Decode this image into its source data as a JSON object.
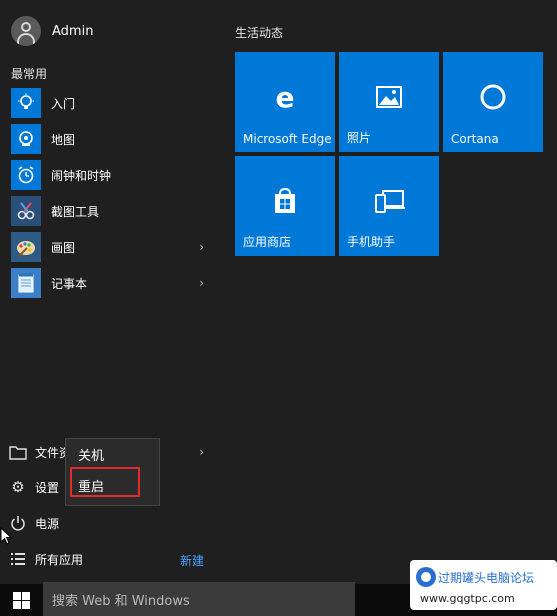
{
  "user": {
    "name": "Admin"
  },
  "most_used_label": "最常用",
  "apps": [
    {
      "label": "入门",
      "icon": "lightbulb-icon",
      "has_submenu": false
    },
    {
      "label": "地图",
      "icon": "maps-icon",
      "has_submenu": false
    },
    {
      "label": "闹钟和时钟",
      "icon": "alarm-clock-icon",
      "has_submenu": false
    },
    {
      "label": "截图工具",
      "icon": "snipping-tool-icon",
      "has_submenu": false
    },
    {
      "label": "画图",
      "icon": "paint-icon",
      "has_submenu": true
    },
    {
      "label": "记事本",
      "icon": "notepad-icon",
      "has_submenu": true
    }
  ],
  "live_section_label": "生活动态",
  "tiles": [
    {
      "label": "Microsoft Edge",
      "icon": "edge-icon"
    },
    {
      "label": "照片",
      "icon": "photos-icon"
    },
    {
      "label": "Cortana",
      "icon": "cortana-icon"
    },
    {
      "label": "应用商店",
      "icon": "store-icon"
    },
    {
      "label": "手机助手",
      "icon": "phone-companion-icon"
    }
  ],
  "system": {
    "file_explorer": "文件资",
    "settings": "设置",
    "power": "电源",
    "all_apps": "所有应用",
    "new_badge": "新建"
  },
  "power_menu": {
    "shutdown": "关机",
    "restart": "重启"
  },
  "taskbar": {
    "search_placeholder": "搜索 Web 和 Windows"
  },
  "watermark": {
    "text": "过期罐头电脑论坛",
    "url": "www.gqgtpc.com"
  },
  "colors": {
    "tile_blue": "#0078d7",
    "highlight_red": "#e02b2b",
    "background": "#1f1f1f"
  }
}
